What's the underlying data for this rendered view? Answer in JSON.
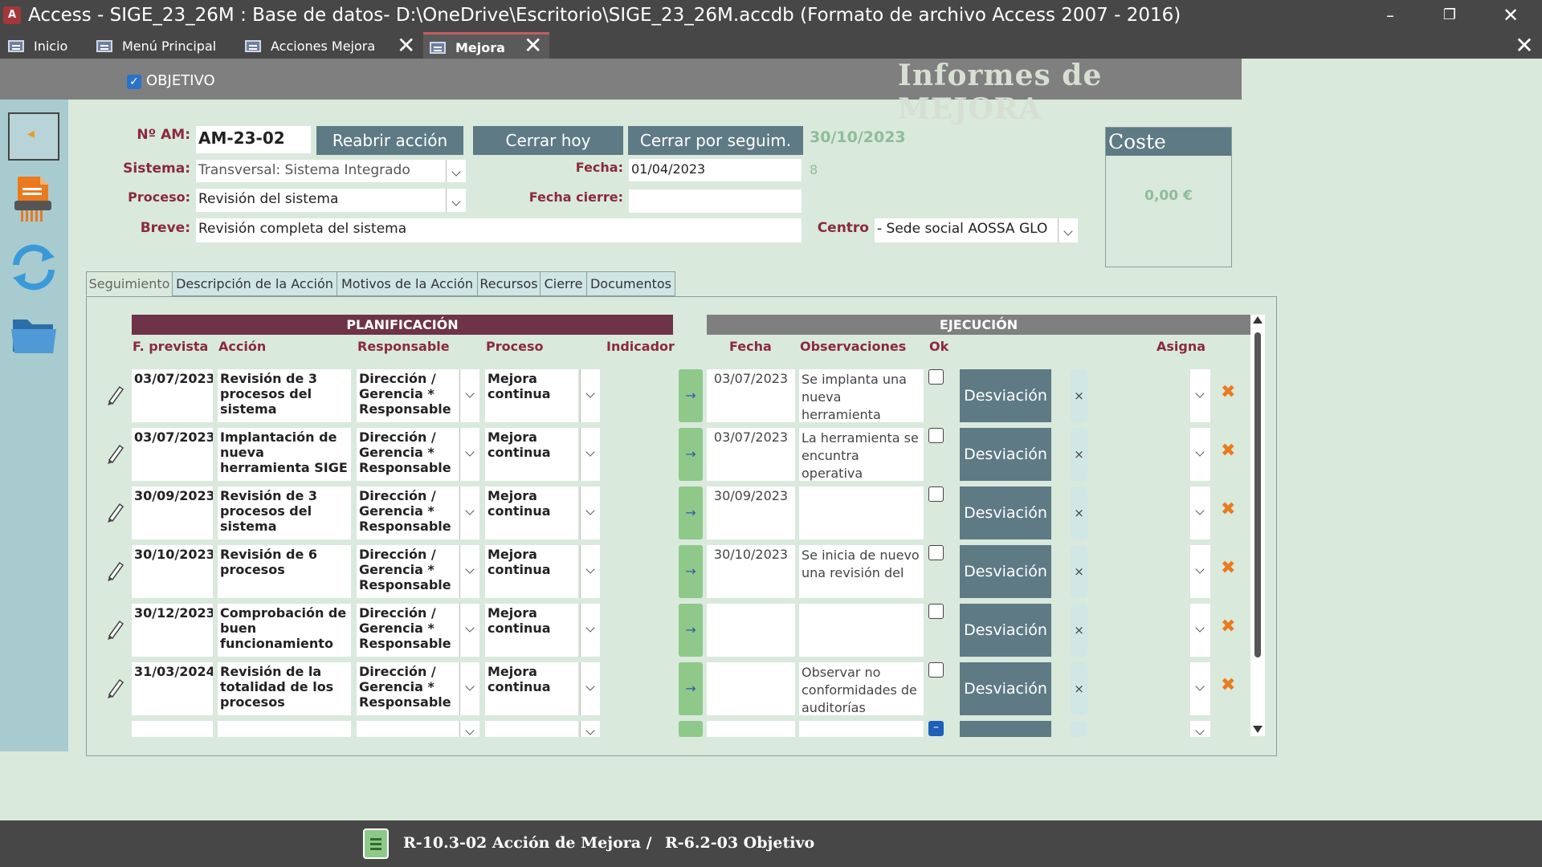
{
  "window": {
    "title": "Access - SIGE_23_26M : Base de datos- D:\\OneDrive\\Escritorio\\SIGE_23_26M.accdb (Formato de archivo Access 2007 - 2016)",
    "app_icon": "A"
  },
  "doc_tabs": [
    {
      "label": "Inicio"
    },
    {
      "label": "Menú Principal"
    },
    {
      "label": "Acciones Mejora"
    },
    {
      "label": "Mejora"
    }
  ],
  "header": {
    "objetivo_label": "OBJETIVO",
    "form_title": "Informes de MEJORA"
  },
  "fields": {
    "n_am_label": "Nº AM:",
    "n_am_value": "AM-23-02",
    "reabrir_label": "Reabrir acción",
    "cerrar_hoy_label": "Cerrar hoy",
    "cerrar_seguim_label": "Cerrar por seguim.",
    "date_display": "30/10/2023",
    "sistema_label": "Sistema:",
    "sistema_value": "Transversal: Sistema Integrado",
    "fecha_label": "Fecha:",
    "fecha_value": "01/04/2023",
    "fecha_extra": "8",
    "proceso_label": "Proceso:",
    "proceso_value": "Revisión del sistema",
    "fecha_cierre_label": "Fecha cierre:",
    "fecha_cierre_value": "",
    "breve_label": "Breve:",
    "breve_value": "Revisión completa del sistema",
    "centro_label": "Centro",
    "centro_value": "- Sede social AOSSA GLO"
  },
  "cost": {
    "title": "Coste",
    "value": "0,00 €"
  },
  "sub_tabs": [
    {
      "label": "Seguimiento"
    },
    {
      "label": "Descripción de la Acción"
    },
    {
      "label": "Motivos de la Acción"
    },
    {
      "label": "Recursos"
    },
    {
      "label": "Cierre"
    },
    {
      "label": "Documentos"
    }
  ],
  "grid": {
    "band_planificacion": "PLANIFICACIÓN",
    "band_ejecucion": "EJECUCIÓN",
    "col_f_prevista": "F. prevista",
    "col_accion": "Acción",
    "col_responsable": "Responsable",
    "col_proceso": "Proceso",
    "col_indicador": "Indicador",
    "col_fecha": "Fecha",
    "col_observaciones": "Observaciones",
    "col_ok": "Ok",
    "col_asigna": "Asigna",
    "deviation_label": "Desviación",
    "rows": [
      {
        "f_prevista": "03/07/2023",
        "accion": "Revisión de 3 procesos del sistema",
        "responsable": "Dirección / Gerencia * Responsable",
        "proceso": "Mejora continua",
        "fecha": "03/07/2023",
        "observaciones": "Se implanta una nueva herramienta"
      },
      {
        "f_prevista": "03/07/2023",
        "accion": "Implantación de nueva herramienta SIGE",
        "responsable": "Dirección / Gerencia * Responsable",
        "proceso": "Mejora continua",
        "fecha": "03/07/2023",
        "observaciones": "La herramienta se encuntra operativa"
      },
      {
        "f_prevista": "30/09/2023",
        "accion": "Revisión de 3 procesos del sistema",
        "responsable": "Dirección / Gerencia * Responsable",
        "proceso": "Mejora continua",
        "fecha": "30/09/2023",
        "observaciones": ""
      },
      {
        "f_prevista": "30/10/2023",
        "accion": "Revisión de 6 procesos",
        "responsable": "Dirección / Gerencia * Responsable",
        "proceso": "Mejora continua",
        "fecha": "30/10/2023",
        "observaciones": "Se inicia de nuevo una revisión del"
      },
      {
        "f_prevista": "30/12/2023",
        "accion": "Comprobación de buen funcionamiento",
        "responsable": "Dirección / Gerencia * Responsable",
        "proceso": "Mejora continua",
        "fecha": "",
        "observaciones": ""
      },
      {
        "f_prevista": "31/03/2024",
        "accion": "Revisión de la totalidad de los procesos",
        "responsable": "Dirección / Gerencia * Responsable",
        "proceso": "Mejora continua",
        "fecha": "",
        "observaciones": "Observar no conformidades de auditorías"
      }
    ]
  },
  "footer": {
    "text1": "R-10.3-02 Acción de Mejora /",
    "text2": "R-6.2-03 Objetivo"
  },
  "colors": {
    "accent_maroon": "#8a2a3d",
    "band_planificacion": "#6e3348",
    "band_ejecucion": "#7f7f7f",
    "button_slate": "#5e7a84",
    "background": "#d9e9dc",
    "sidebar": "#a8cbd0",
    "delete_orange": "#ea7a1d"
  },
  "icons": {
    "exit": "exit-icon",
    "pdf": "pdf-document-icon",
    "refresh": "refresh-icon",
    "folder": "folder-icon",
    "edit": "pencil-icon",
    "footer": "clipboard-icon"
  }
}
